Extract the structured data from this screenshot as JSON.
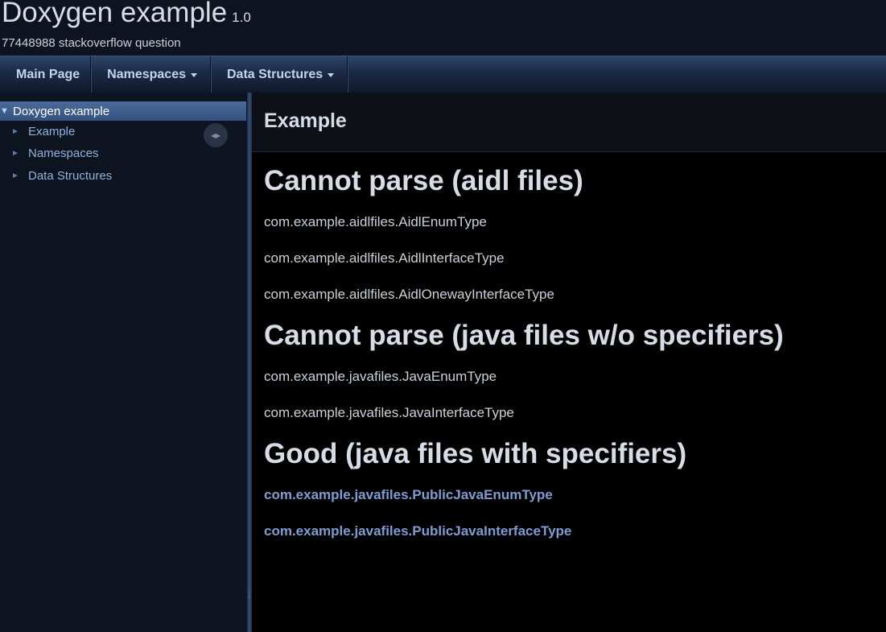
{
  "title_area": {
    "project_name": "Doxygen example",
    "project_number": "1.0",
    "project_brief": "77448988 stackoverflow question"
  },
  "navbar": {
    "items": [
      {
        "label": "Main Page",
        "dropdown": false
      },
      {
        "label": "Namespaces",
        "dropdown": true
      },
      {
        "label": "Data Structures",
        "dropdown": true
      }
    ]
  },
  "sidebar": {
    "root": "Doxygen example",
    "items": [
      {
        "label": "Example"
      },
      {
        "label": "Namespaces"
      },
      {
        "label": "Data Structures"
      }
    ]
  },
  "page": {
    "title": "Example",
    "sections": [
      {
        "heading": "Cannot parse (aidl files)",
        "entries": [
          {
            "text": "com.example.aidlfiles.AidlEnumType",
            "link": false
          },
          {
            "text": "com.example.aidlfiles.AidlInterfaceType",
            "link": false
          },
          {
            "text": "com.example.aidlfiles.AidlOnewayInterfaceType",
            "link": false
          }
        ]
      },
      {
        "heading": "Cannot parse (java files w/o specifiers)",
        "entries": [
          {
            "text": "com.example.javafiles.JavaEnumType",
            "link": false
          },
          {
            "text": "com.example.javafiles.JavaInterfaceType",
            "link": false
          }
        ]
      },
      {
        "heading": "Good (java files with specifiers)",
        "entries": [
          {
            "text": "com.example.javafiles.PublicJavaEnumType",
            "link": true
          },
          {
            "text": "com.example.javafiles.PublicJavaInterfaceType",
            "link": true
          }
        ]
      }
    ]
  },
  "colors": {
    "background": "#000000",
    "navbar": "#1a2a46",
    "sidebar_selected": "#4b6b9c",
    "link": "#7f9cd1",
    "text": "#c9d1d9"
  }
}
